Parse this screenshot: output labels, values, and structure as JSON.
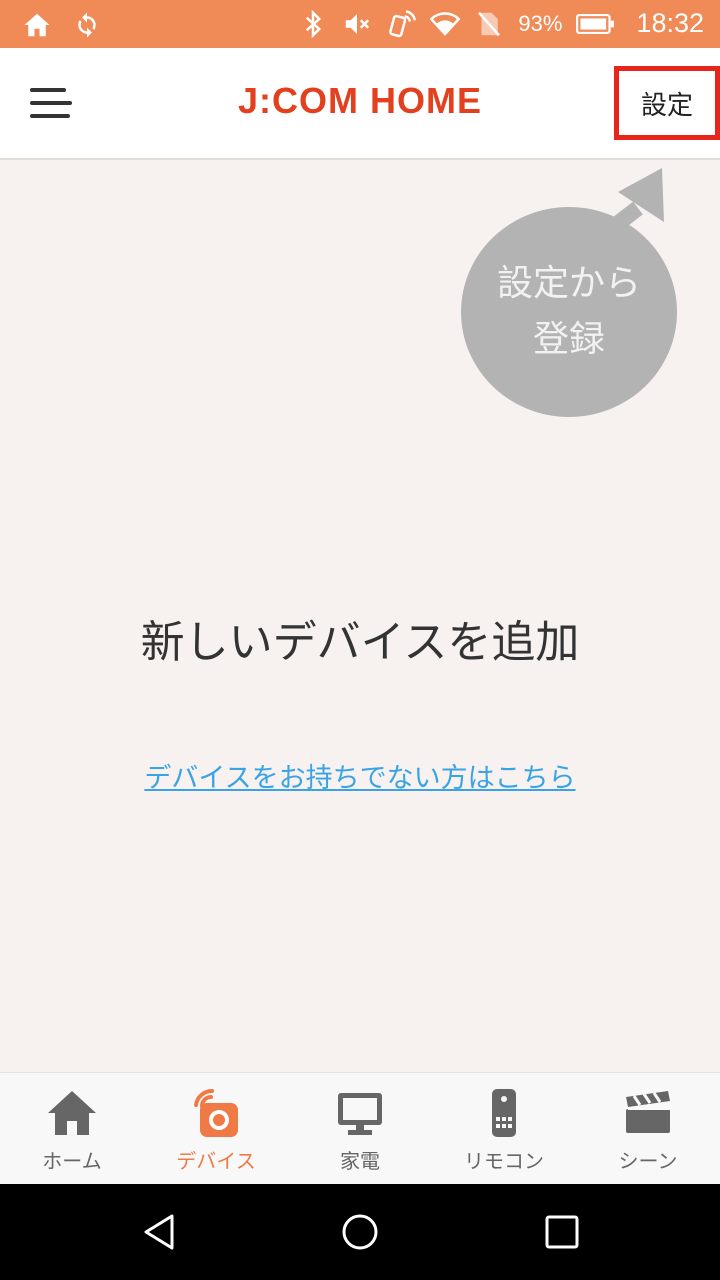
{
  "status_bar": {
    "battery_percent": "93%",
    "time": "18:32",
    "icons": [
      "home-icon",
      "sync-icon",
      "bluetooth-icon",
      "mute-icon",
      "nfc-icon",
      "wifi-icon",
      "no-sim-icon",
      "battery-icon"
    ]
  },
  "header": {
    "brand": "J:COM HOME",
    "settings_label": "設定",
    "menu_icon": "hamburger-menu-icon"
  },
  "hint": {
    "line1": "設定から",
    "line2": "登録"
  },
  "main": {
    "title": "新しいデバイスを追加",
    "link": "デバイスをお持ちでない方はこちら"
  },
  "tabs": [
    {
      "label": "ホーム",
      "icon": "home-icon"
    },
    {
      "label": "デバイス",
      "icon": "device-icon",
      "active": true
    },
    {
      "label": "家電",
      "icon": "monitor-icon"
    },
    {
      "label": "リモコン",
      "icon": "remote-icon"
    },
    {
      "label": "シーン",
      "icon": "clapperboard-icon"
    }
  ],
  "colors": {
    "status_bar": "#f08a57",
    "brand": "#e2401e",
    "accent": "#ef7a45",
    "highlight_box": "#e8251b",
    "link": "#3aa3e6",
    "background": "#f7f2ef"
  }
}
